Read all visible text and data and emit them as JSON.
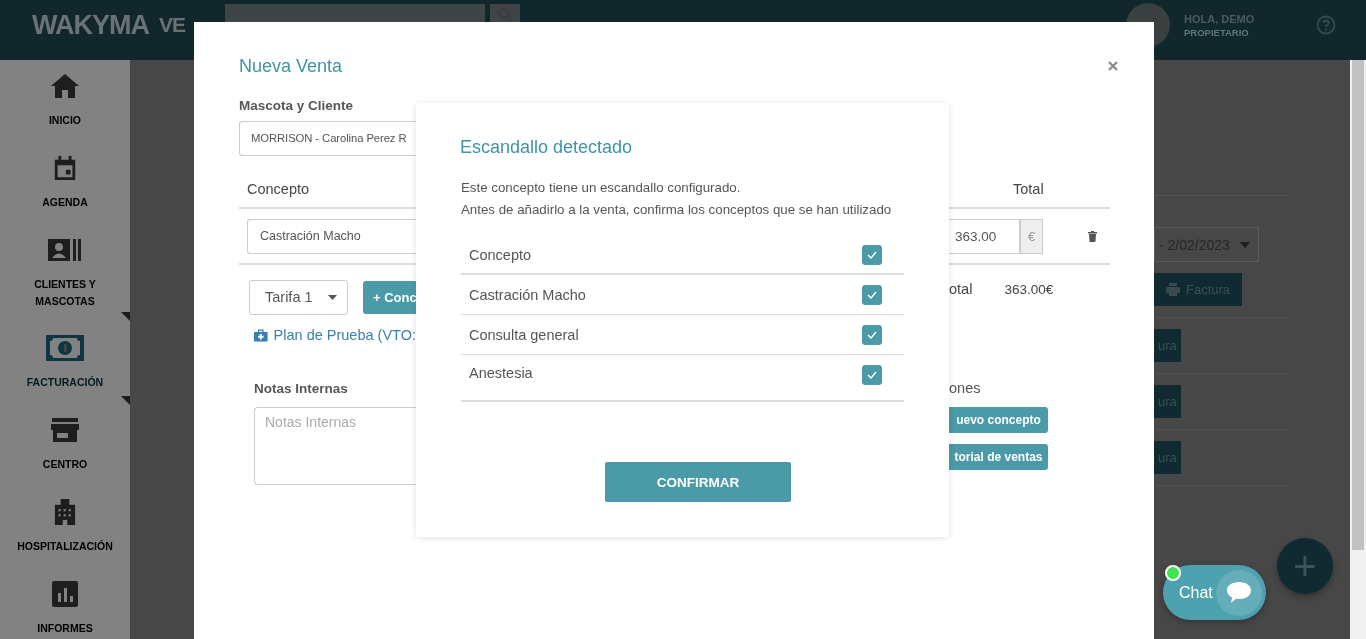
{
  "header": {
    "logo": "WAKYMA",
    "logo_cut": "VE",
    "greeting": "HOLA, DEMO",
    "role": "PROPIETARIO"
  },
  "sidebar": {
    "items": [
      {
        "label": "INICIO",
        "selected": false,
        "has_submenu": false
      },
      {
        "label": "AGENDA",
        "selected": false,
        "has_submenu": false
      },
      {
        "label": "CLIENTES Y MASCOTAS",
        "selected": false,
        "has_submenu": true
      },
      {
        "label": "FACTURACIÓN",
        "selected": true,
        "has_submenu": true
      },
      {
        "label": "CENTRO",
        "selected": false,
        "has_submenu": false
      },
      {
        "label": "HOSPITALIZACIÓN",
        "selected": false,
        "has_submenu": false
      },
      {
        "label": "INFORMES",
        "selected": false,
        "has_submenu": false
      }
    ]
  },
  "background": {
    "date_range": "- 2/02/2023",
    "invoice_buttons": [
      "Factura",
      "ura",
      "ura",
      "ura"
    ]
  },
  "modal": {
    "title": "Nueva Venta",
    "client_label": "Mascota y Cliente",
    "client_value": "MORRISON - Carolina Perez R",
    "concept_header": "Concepto",
    "total_header": "Total",
    "lines": [
      {
        "concept": "Castración Macho",
        "price": "363.00",
        "currency": "€"
      }
    ],
    "tariff": "Tarifa 1",
    "add_concept_button": "+ Conc",
    "subtotal_label": "otal",
    "subtotal_value": "363.00€",
    "plan_link": "Plan de Prueba (VTO:",
    "notes_label": "Notas Internas",
    "notes_placeholder": "Notas Internas",
    "actions_label": "ones",
    "action_buttons": [
      "uevo concepto",
      "torial de ventas"
    ]
  },
  "dialog": {
    "title": "Escandallo detectado",
    "message_lines": [
      "Este concepto tiene un escandallo configurado.",
      "Antes de añadirlo a la venta, confirma los conceptos que se han utilizado"
    ],
    "header": {
      "label": "Concepto",
      "checked": true
    },
    "rows": [
      {
        "label": "Castración Macho",
        "checked": true
      },
      {
        "label": "Consulta general",
        "checked": true
      },
      {
        "label": "Anestesia",
        "checked": true
      }
    ],
    "confirm_button": "CONFIRMAR"
  },
  "chat": {
    "label": "Chat",
    "online": true
  },
  "fab": {
    "label": "+"
  }
}
